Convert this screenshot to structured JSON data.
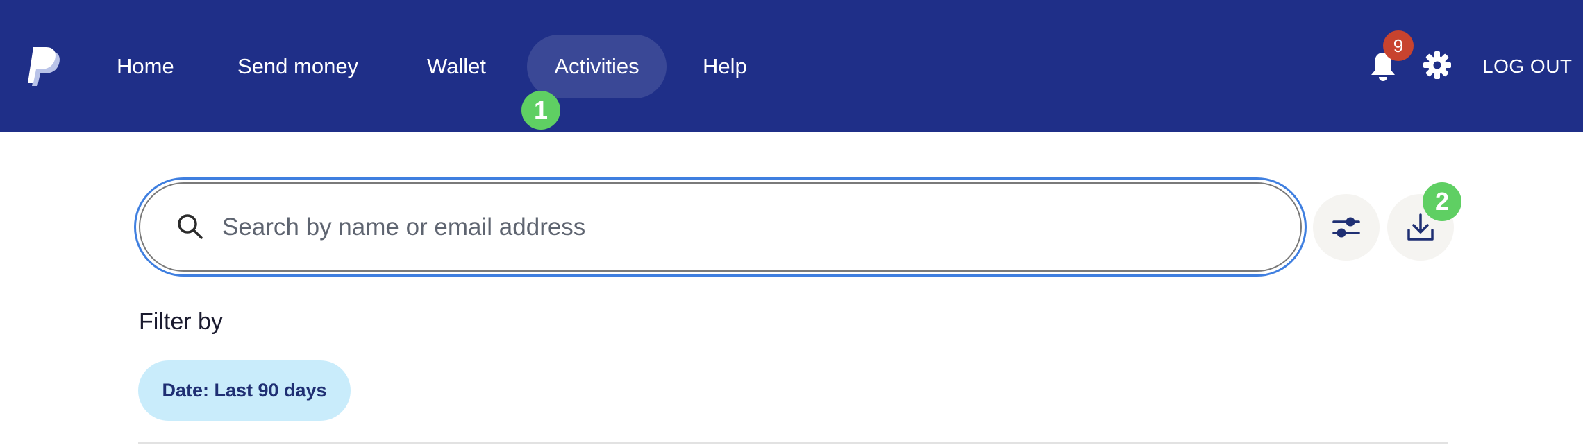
{
  "nav": {
    "items": [
      {
        "label": "Home"
      },
      {
        "label": "Send money"
      },
      {
        "label": "Wallet"
      },
      {
        "label": "Activities",
        "active": true
      },
      {
        "label": "Help"
      }
    ],
    "notification_count": "9",
    "logout_label": "LOG OUT"
  },
  "annotations": {
    "step_1": "1",
    "step_2": "2"
  },
  "search": {
    "placeholder": "Search by name or email address",
    "value": ""
  },
  "filters": {
    "title": "Filter by",
    "chip_label": "Date: Last 90 days"
  },
  "icons": {
    "logo": "paypal-logo",
    "bell": "bell-icon",
    "settings": "gear-icon",
    "search": "search-icon",
    "filter": "sliders-icon",
    "download": "download-icon"
  },
  "colors": {
    "nav_background": "#1f2f88",
    "step_badge": "#5fcf63",
    "notification_badge": "#c8432e",
    "search_focus": "#3f7fe0",
    "chip_background": "#c9ecfb",
    "chip_text": "#1f2f73"
  }
}
